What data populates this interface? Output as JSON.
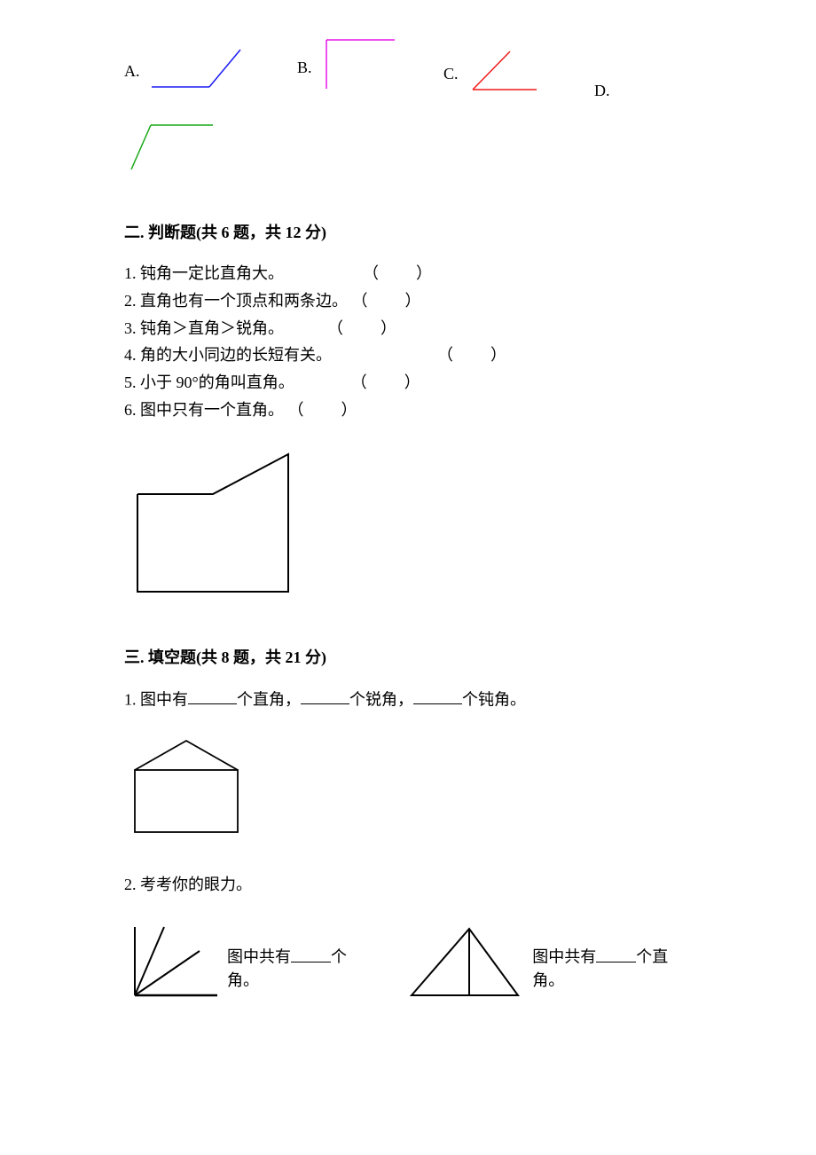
{
  "options": {
    "a": "A.",
    "b": "B.",
    "c": "C.",
    "d": "D."
  },
  "section2": {
    "header": "二. 判断题(共 6 题，共 12 分)",
    "q1": "1. 钝角一定比直角大。",
    "q2": "2. 直角也有一个顶点和两条边。",
    "q3": "3. 钝角＞直角＞锐角。",
    "q4": "4. 角的大小同边的长短有关。",
    "q5": "5. 小于 90°的角叫直角。",
    "q6": "6. 图中只有一个直角。",
    "paren": "（　　）"
  },
  "section3": {
    "header": "三. 填空题(共 8 题，共 21 分)",
    "q1_a": "1. 图中有",
    "q1_b": "个直角，",
    "q1_c": "个锐角，",
    "q1_d": "个钝角。",
    "q2": "2. 考考你的眼力。",
    "q2a_a": "图中共有",
    "q2a_b": "个角。",
    "q2b_a": "图中共有",
    "q2b_b": "个直角。"
  }
}
